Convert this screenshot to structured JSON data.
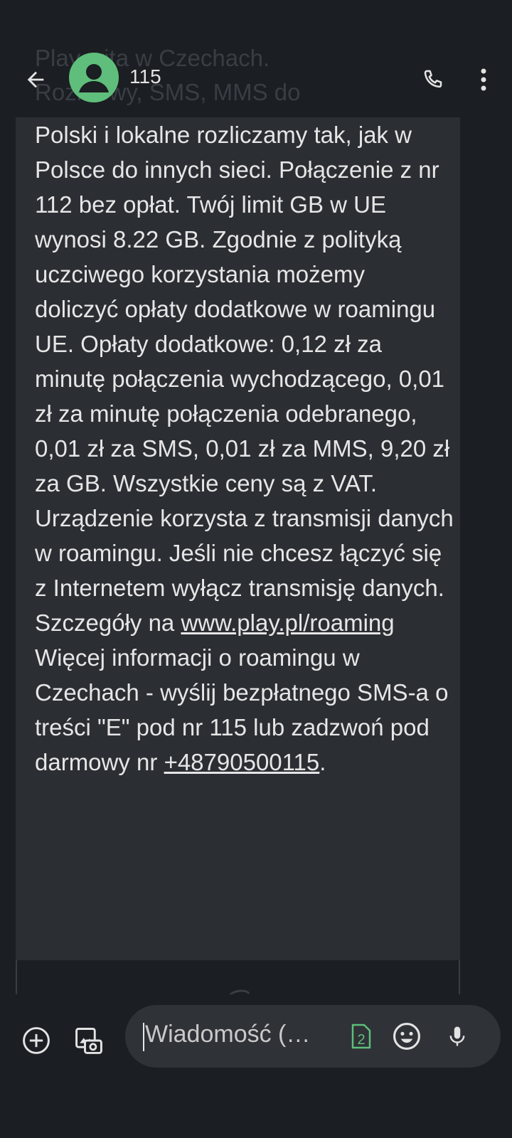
{
  "header": {
    "contact": "115",
    "ghost_text": "Play wita w Czechach.\nRozmowy, SMS, MMS do"
  },
  "message": {
    "text_before_link1": "Polski i lokalne rozliczamy tak, jak w Polsce do innych sieci. Połączenie z nr 112 bez opłat. Twój limit GB w UE wynosi 8.22 GB. Zgodnie z polityką uczciwego korzystania możemy doliczyć opłaty dodatkowe w roamingu UE. Opłaty dodatkowe: 0,12 zł za minutę połączenia wychodzącego, 0,01 zł za minutę połączenia odebranego, 0,01 zł za SMS, 0,01 zł za MMS, 9,20 zł za GB. Wszystkie ceny są z VAT. Urządzenie korzysta z transmisji danych w roamingu. Jeśli nie chcesz łączyć się z Internetem wyłącz transmisję danych. Szczegóły na ",
    "link1": "www.play.pl/roaming",
    "text_between": " Więcej informacji o roamingu w Czechach - wyślij bezpłatnego SMS-a o treści \"E\" pod nr 115 lub zadzwoń pod darmowy nr ",
    "link2": "+48790500115",
    "text_after": "."
  },
  "composer": {
    "placeholder": "Wiadomość (…",
    "sim_number": "2"
  },
  "icons": {
    "back": "arrow-back-icon",
    "call": "phone-icon",
    "more": "more-vert-icon",
    "add": "add-circle-icon",
    "media": "gallery-icon",
    "sim": "sim-card-icon",
    "emoji": "emoji-icon",
    "mic": "mic-icon"
  },
  "colors": {
    "background": "#1b1e22",
    "bubble": "#2b2e33",
    "avatar": "#5fbe7b",
    "sim_green": "#5fbe7b",
    "input": "#2f3237"
  }
}
